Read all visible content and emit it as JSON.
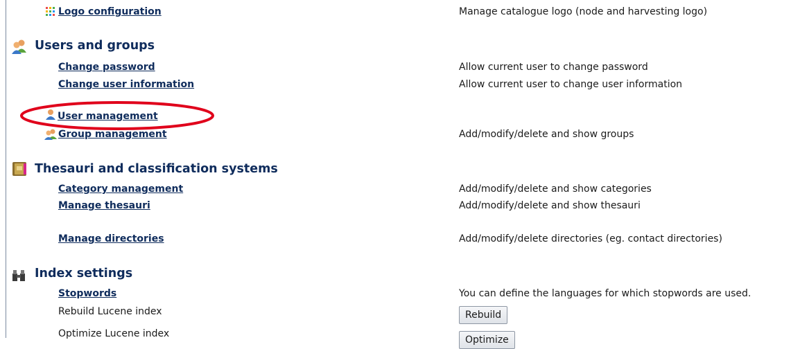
{
  "logo_config": {
    "label": "Logo configuration",
    "desc": "Manage catalogue logo (node and harvesting logo)"
  },
  "users_groups": {
    "title": "Users and groups",
    "change_password": {
      "label": "Change password",
      "desc": "Allow current user to change password"
    },
    "change_user_info": {
      "label": "Change user information",
      "desc": "Allow current user to change user information"
    },
    "user_management": {
      "label": "User management"
    },
    "group_management": {
      "label": "Group management",
      "desc": "Add/modify/delete and show groups"
    }
  },
  "thesauri": {
    "title": "Thesauri and classification systems",
    "category_management": {
      "label": "Category management",
      "desc": "Add/modify/delete and show categories"
    },
    "manage_thesauri": {
      "label": "Manage thesauri",
      "desc": "Add/modify/delete and show thesauri"
    },
    "manage_directories": {
      "label": "Manage directories",
      "desc": "Add/modify/delete directories (eg. contact directories)"
    }
  },
  "index_settings": {
    "title": "Index settings",
    "stopwords": {
      "label": "Stopwords",
      "desc": "You can define the languages for which stopwords are used."
    },
    "rebuild": {
      "label": "Rebuild Lucene index",
      "button": "Rebuild"
    },
    "optimize": {
      "label": "Optimize Lucene index",
      "button": "Optimize"
    }
  },
  "highlight_color": "#e0001b"
}
